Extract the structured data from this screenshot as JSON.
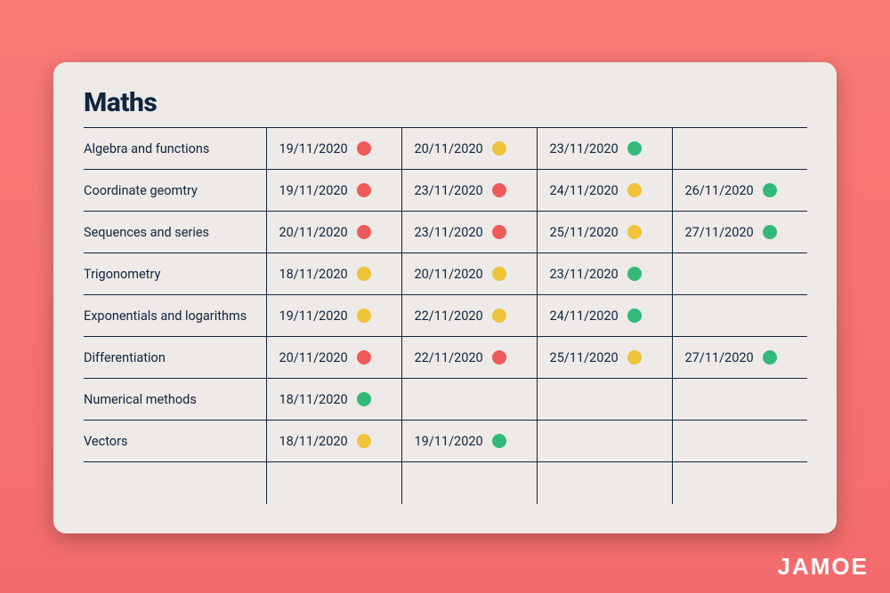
{
  "brand": "JAMOE",
  "card": {
    "title": "Maths",
    "columns": 4,
    "colors": {
      "red": "#ef5b5a",
      "amber": "#efc33a",
      "green": "#32b97a"
    },
    "rows": [
      {
        "topic": "Algebra and functions",
        "attempts": [
          {
            "date": "19/11/2020",
            "status": "red"
          },
          {
            "date": "20/11/2020",
            "status": "amber"
          },
          {
            "date": "23/11/2020",
            "status": "green"
          }
        ]
      },
      {
        "topic": "Coordinate geomtry",
        "attempts": [
          {
            "date": "19/11/2020",
            "status": "red"
          },
          {
            "date": "23/11/2020",
            "status": "red"
          },
          {
            "date": "24/11/2020",
            "status": "amber"
          },
          {
            "date": "26/11/2020",
            "status": "green"
          }
        ]
      },
      {
        "topic": "Sequences and series",
        "attempts": [
          {
            "date": "20/11/2020",
            "status": "red"
          },
          {
            "date": "23/11/2020",
            "status": "red"
          },
          {
            "date": "25/11/2020",
            "status": "amber"
          },
          {
            "date": "27/11/2020",
            "status": "green"
          }
        ]
      },
      {
        "topic": "Trigonometry",
        "attempts": [
          {
            "date": "18/11/2020",
            "status": "amber"
          },
          {
            "date": "20/11/2020",
            "status": "amber"
          },
          {
            "date": "23/11/2020",
            "status": "green"
          }
        ]
      },
      {
        "topic": "Exponentials and logarithms",
        "attempts": [
          {
            "date": "19/11/2020",
            "status": "amber"
          },
          {
            "date": "22/11/2020",
            "status": "amber"
          },
          {
            "date": "24/11/2020",
            "status": "green"
          }
        ]
      },
      {
        "topic": "Differentiation",
        "attempts": [
          {
            "date": "20/11/2020",
            "status": "red"
          },
          {
            "date": "22/11/2020",
            "status": "red"
          },
          {
            "date": "25/11/2020",
            "status": "amber"
          },
          {
            "date": "27/11/2020",
            "status": "green"
          }
        ]
      },
      {
        "topic": "Numerical methods",
        "attempts": [
          {
            "date": "18/11/2020",
            "status": "green"
          }
        ]
      },
      {
        "topic": "Vectors",
        "attempts": [
          {
            "date": "18/11/2020",
            "status": "amber"
          },
          {
            "date": "19/11/2020",
            "status": "green"
          }
        ]
      }
    ]
  }
}
